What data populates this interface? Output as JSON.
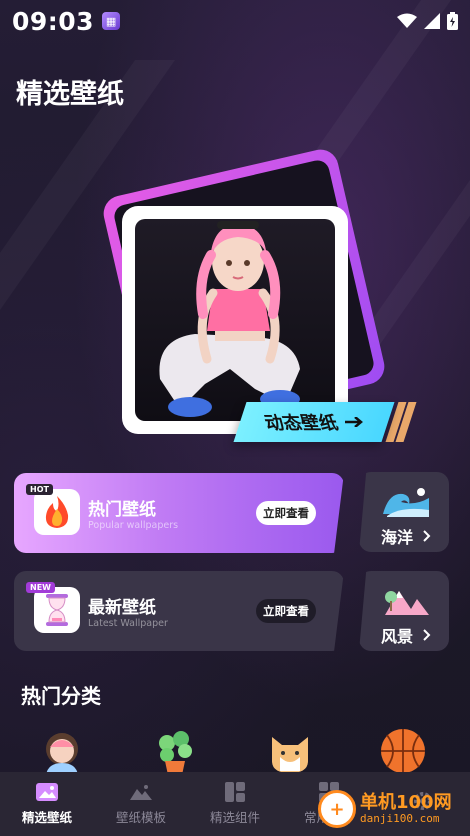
{
  "status_bar": {
    "time": "09:03"
  },
  "page": {
    "title": "精选壁纸"
  },
  "hero": {
    "tag_label": "动态壁纸"
  },
  "cards": {
    "hot": {
      "badge": "HOT",
      "title": "热门壁纸",
      "subtitle": "Popular wallpapers",
      "button": "立即查看"
    },
    "new": {
      "badge": "NEW",
      "title": "最新壁纸",
      "subtitle": "Latest Wallpaper",
      "button": "立即查看"
    },
    "ocean": {
      "label": "海洋"
    },
    "scenery": {
      "label": "风景"
    }
  },
  "categories": {
    "title": "热门分类"
  },
  "nav": {
    "items": [
      {
        "label": "精选壁纸",
        "active": true
      },
      {
        "label": "壁纸模板",
        "active": false
      },
      {
        "label": "精选组件",
        "active": false
      },
      {
        "label": "常用组件",
        "active": false
      }
    ]
  },
  "watermark": {
    "name": "单机100网",
    "url": "danji100.com"
  },
  "colors": {
    "accent_purple": "#b06df2",
    "cyan_tag": "#5fe3ff",
    "nav_bg": "#2a2634"
  }
}
